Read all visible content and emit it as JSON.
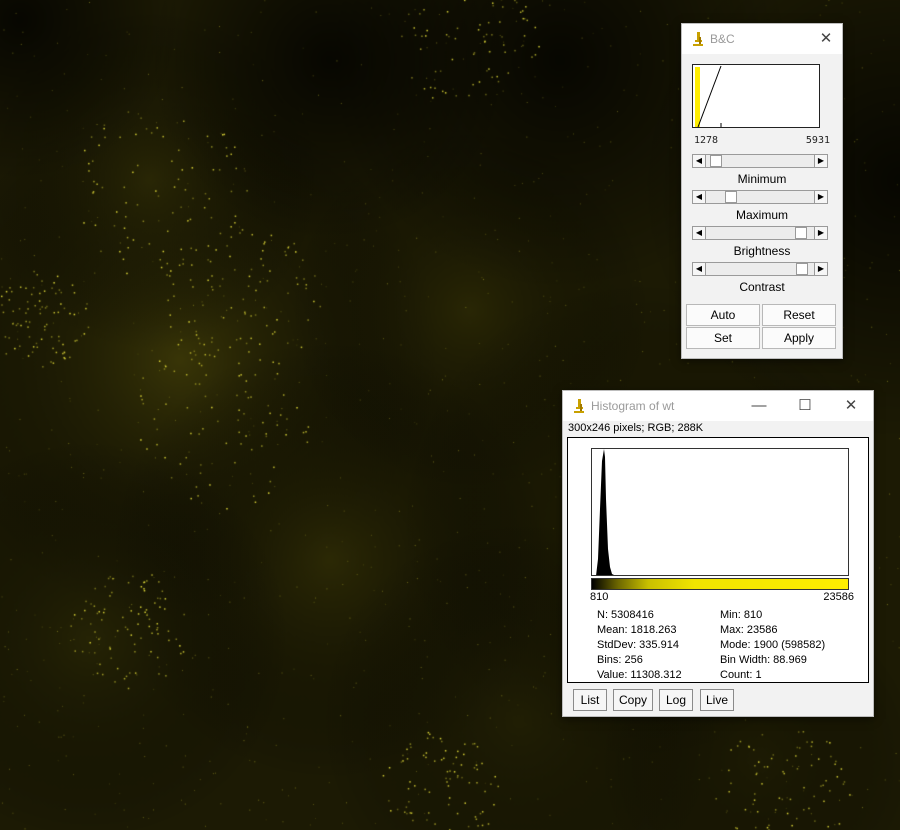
{
  "colors": {
    "speckle": "#e8e23a",
    "accent_yellow": "#ffee00",
    "window_bg": "#f2f2f2"
  },
  "bc": {
    "title": "B&C",
    "icon": "imagej-microscope-icon",
    "display_min": "1278",
    "display_max": "5931",
    "sliders": [
      {
        "label": "Minimum",
        "level": 0.05
      },
      {
        "label": "Maximum",
        "level": 0.2
      },
      {
        "label": "Brightness",
        "level": 0.92
      },
      {
        "label": "Contrast",
        "level": 0.93
      }
    ],
    "buttons": {
      "auto": "Auto",
      "reset": "Reset",
      "set": "Set",
      "apply": "Apply"
    }
  },
  "histogram": {
    "title": "Histogram of wt",
    "info": "300x246 pixels; RGB; 288K",
    "axis_min": "810",
    "axis_max": "23586",
    "stats_left": [
      "N: 5308416",
      "Mean: 1818.263",
      "StdDev: 335.914",
      "Bins: 256",
      "Value: 11308.312"
    ],
    "stats_right": [
      "Min: 810",
      "Max: 23586",
      "Mode: 1900 (598582)",
      "Bin Width: 88.969",
      "Count: 1"
    ],
    "buttons": {
      "list": "List",
      "copy": "Copy",
      "log": "Log",
      "live": "Live"
    }
  }
}
